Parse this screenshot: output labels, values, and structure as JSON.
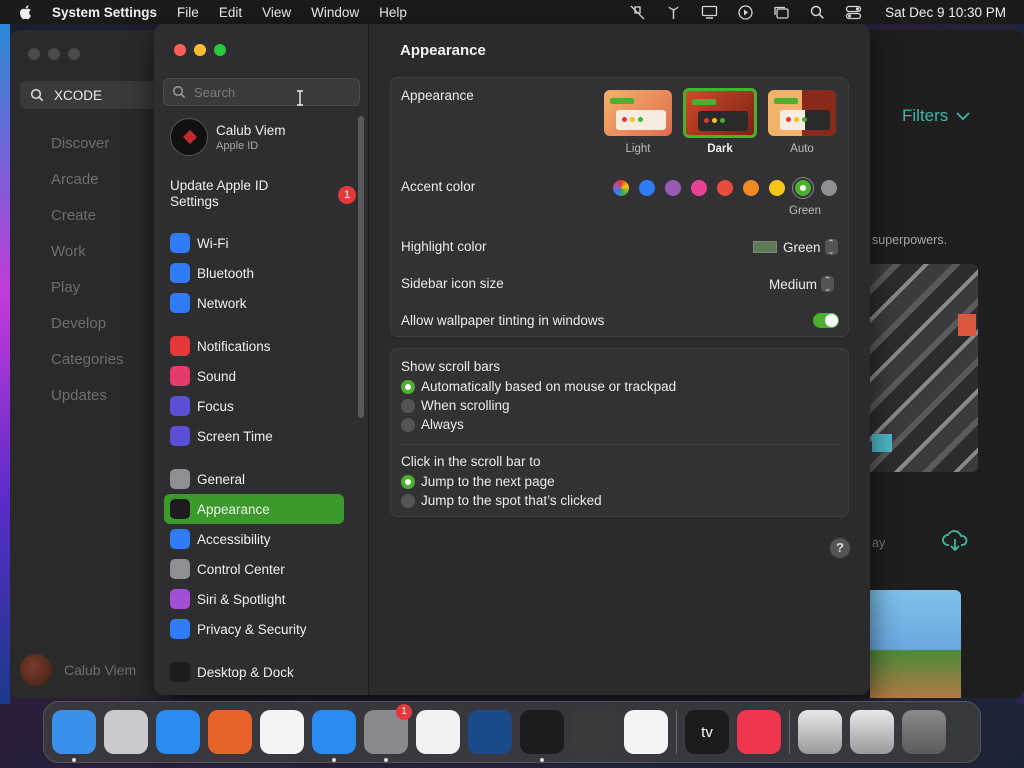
{
  "menubar": {
    "app_name": "System Settings",
    "items": [
      "File",
      "Edit",
      "View",
      "Window",
      "Help"
    ],
    "clock": "Sat Dec 9  10:30 PM",
    "status_icons": [
      "mic-off-icon",
      "antenna-icon",
      "display-icon",
      "play-circle-icon",
      "windows-icon",
      "search-icon",
      "control-center-icon"
    ]
  },
  "appstore": {
    "search_value": "XCODE",
    "nav": [
      "Discover",
      "Arcade",
      "Create",
      "Work",
      "Play",
      "Develop",
      "Categories",
      "Updates"
    ],
    "user_name": "Calub Viem",
    "filters_label": "Filters",
    "promo_text": "superpowers.",
    "day_text": "ay"
  },
  "settings": {
    "search_placeholder": "Search",
    "profile": {
      "name": "Calub Viem",
      "sub": "Apple ID"
    },
    "update": {
      "label": "Update Apple ID Settings",
      "badge": "1"
    },
    "sidebar_groups": [
      [
        {
          "label": "Wi-Fi",
          "icon": "wifi-icon",
          "color": "#2f7cf6"
        },
        {
          "label": "Bluetooth",
          "icon": "bluetooth-icon",
          "color": "#2f7cf6"
        },
        {
          "label": "Network",
          "icon": "globe-icon",
          "color": "#2f7cf6"
        }
      ],
      [
        {
          "label": "Notifications",
          "icon": "bell-icon",
          "color": "#e5383b"
        },
        {
          "label": "Sound",
          "icon": "speaker-icon",
          "color": "#e53b6b"
        },
        {
          "label": "Focus",
          "icon": "moon-icon",
          "color": "#5b4fd6"
        },
        {
          "label": "Screen Time",
          "icon": "hourglass-icon",
          "color": "#5b4fd6"
        }
      ],
      [
        {
          "label": "General",
          "icon": "gear-icon",
          "color": "#8e8e93"
        },
        {
          "label": "Appearance",
          "icon": "appearance-icon",
          "color": "#1c1c1e",
          "selected": true
        },
        {
          "label": "Accessibility",
          "icon": "accessibility-icon",
          "color": "#2f7cf6"
        },
        {
          "label": "Control Center",
          "icon": "control-center-icon",
          "color": "#8e8e93"
        },
        {
          "label": "Siri & Spotlight",
          "icon": "siri-icon",
          "color": "#a04fd6"
        },
        {
          "label": "Privacy & Security",
          "icon": "hand-icon",
          "color": "#2f7cf6"
        }
      ],
      [
        {
          "label": "Desktop & Dock",
          "icon": "dock-icon",
          "color": "#1c1c1e"
        }
      ]
    ],
    "title": "Appearance",
    "appearance": {
      "label": "Appearance",
      "options": [
        {
          "label": "Light",
          "selected": false
        },
        {
          "label": "Dark",
          "selected": true
        },
        {
          "label": "Auto",
          "selected": false
        }
      ]
    },
    "accent": {
      "label": "Accent color",
      "colors": [
        "multicolor",
        "#2f7cf6",
        "#9b59b6",
        "#e84393",
        "#e74c3c",
        "#f08a24",
        "#f5c518",
        "#4cb02f",
        "#8e8e93"
      ],
      "selected_name": "Green"
    },
    "highlight": {
      "label": "Highlight color",
      "value": "Green"
    },
    "sidebar_icon_size": {
      "label": "Sidebar icon size",
      "value": "Medium"
    },
    "wallpaper_tinting": {
      "label": "Allow wallpaper tinting in windows",
      "on": true
    },
    "scroll_bars": {
      "label": "Show scroll bars",
      "options": [
        {
          "label": "Automatically based on mouse or trackpad",
          "selected": true
        },
        {
          "label": "When scrolling",
          "selected": false
        },
        {
          "label": "Always",
          "selected": false
        }
      ]
    },
    "click_scroll": {
      "label": "Click in the scroll bar to",
      "options": [
        {
          "label": "Jump to the next page",
          "selected": true
        },
        {
          "label": "Jump to the spot that’s clicked",
          "selected": false
        }
      ]
    },
    "help": "?"
  },
  "dock": {
    "apps": [
      {
        "name": "finder-icon",
        "color": "#3a8fe8",
        "running": true
      },
      {
        "name": "launchpad-icon",
        "color": "#c9c9cf",
        "running": false
      },
      {
        "name": "safari-icon",
        "color": "#2a8bf0",
        "running": false
      },
      {
        "name": "firefox-icon",
        "color": "#e8632a",
        "running": false
      },
      {
        "name": "chrome-icon",
        "color": "#f4f4f4",
        "running": false
      },
      {
        "name": "app-store-icon",
        "color": "#2a8bf0",
        "running": true
      },
      {
        "name": "system-settings-icon",
        "color": "#8a8a8e",
        "running": true,
        "badge": "1"
      },
      {
        "name": "textedit-icon",
        "color": "#f2f2f2",
        "running": false
      },
      {
        "name": "steam-icon",
        "color": "#1b4a8a",
        "running": false
      },
      {
        "name": "terminal-icon",
        "color": "#1c1c1e",
        "running": true
      },
      {
        "name": "garageband-icon",
        "color": "#3a3a3c",
        "running": false
      },
      {
        "name": "vscode-icon",
        "color": "#f4f4f4",
        "running": false
      }
    ],
    "apps2": [
      {
        "name": "apple-tv-icon",
        "color": "#1c1c1e",
        "running": false,
        "text": "tv"
      },
      {
        "name": "music-icon",
        "color": "#f0364f",
        "running": false
      }
    ],
    "stack": [
      "downloads-stack-icon",
      "screenshots-stack-icon",
      "trash-icon"
    ]
  }
}
